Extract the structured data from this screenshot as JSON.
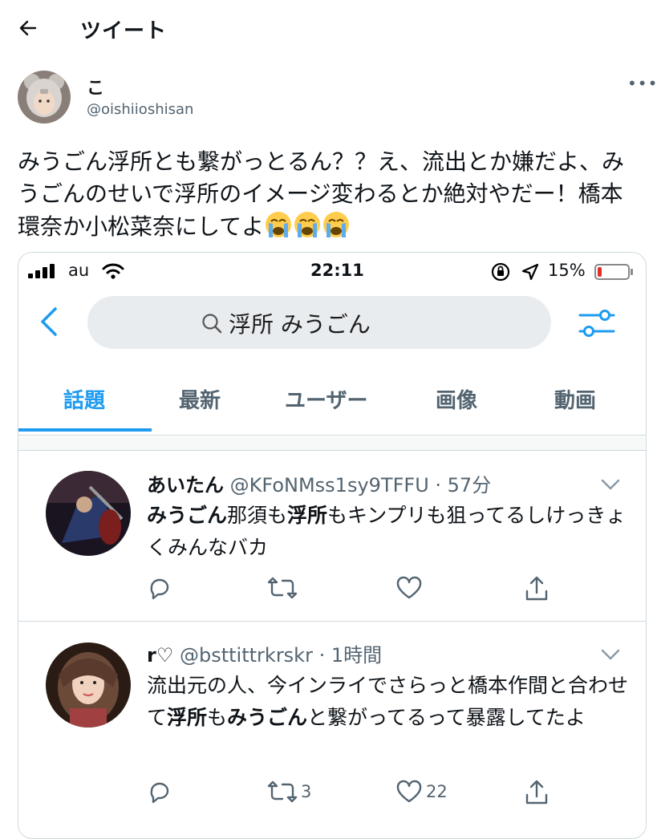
{
  "header": {
    "title": "ツイート"
  },
  "tweet": {
    "display_name": "こ",
    "handle": "@oishiioshisan",
    "text": "みうごん浮所とも繋がっとるん？？え、流出とか嫌だよ、みうごんのせいで浮所のイメージ変わるとか絶対やだー！橋本環奈か小松菜奈にしてよ",
    "emoji": [
      "loudly-crying-face",
      "loudly-crying-face",
      "loudly-crying-face"
    ]
  },
  "screenshot": {
    "status_bar": {
      "carrier": "au",
      "time": "22:11",
      "battery_pct": "15%",
      "battery_level": 0.15
    },
    "search": {
      "query": "浮所 みうごん"
    },
    "tabs": [
      "話題",
      "最新",
      "ユーザー",
      "画像",
      "動画"
    ],
    "active_tab": 0,
    "posts": [
      {
        "name": "あいたん",
        "handle_time": "@KFoNMss1sy9TFFU · 57分",
        "body_segments": [
          {
            "text": "みうごん",
            "bold": true
          },
          {
            "text": "那須も",
            "bold": false
          },
          {
            "text": "浮所",
            "bold": true
          },
          {
            "text": "もキンプリも狙ってるしけっきょくみんなバカ",
            "bold": false
          }
        ],
        "retweets": "",
        "likes": ""
      },
      {
        "name": "r♡",
        "handle_time": "@bsttittrkrskr · 1時間",
        "body_segments": [
          {
            "text": "流出元の人、今インライでさらっと橋本作間と合わせて",
            "bold": false
          },
          {
            "text": "浮所",
            "bold": true
          },
          {
            "text": "も",
            "bold": false
          },
          {
            "text": "みうごん",
            "bold": true
          },
          {
            "text": "と繋がってるって暴露してたよ",
            "bold": false
          }
        ],
        "retweets": "3",
        "likes": "22"
      }
    ]
  },
  "colors": {
    "accent": "#1d9bf0",
    "text": "#0f1419",
    "muted": "#536471",
    "border": "#cfd9de"
  }
}
